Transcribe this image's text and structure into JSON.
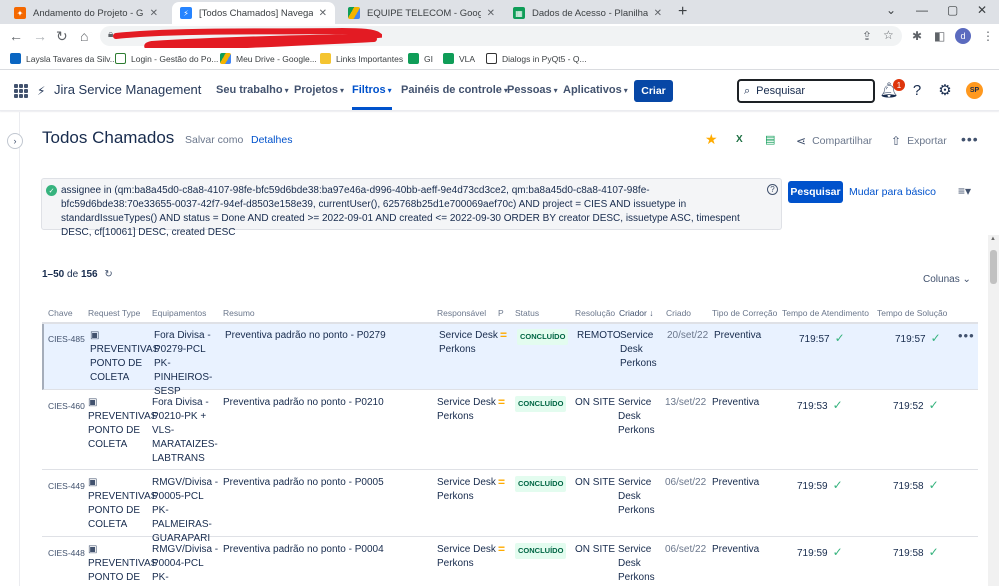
{
  "browser": {
    "tabs": [
      {
        "title": "Andamento do Projeto - Grafana",
        "icon": "grafana-icon",
        "color": "#f46800"
      },
      {
        "title": "[Todos Chamados] Navegador de ite",
        "icon": "jira-icon",
        "color": "#2684ff"
      },
      {
        "title": "EQUIPE TELECOM - Google Drive",
        "icon": "google-drive-icon",
        "color": "#1fa463"
      },
      {
        "title": "Dados de Acesso - Planilhas Google",
        "icon": "google-sheets-icon",
        "color": "#0f9d58"
      }
    ],
    "close_glyph": "✕",
    "new_tab": "+",
    "url": "",
    "profile_initial": "d",
    "bookmarks": [
      {
        "label": "Laysla Tavares da Silv...",
        "color": "#0a66c2"
      },
      {
        "label": "Login - Gestão do Po...",
        "color": "#2e7d32"
      },
      {
        "label": "Meu Drive - Google...",
        "color": "#1fa463"
      },
      {
        "label": "Links Importantes",
        "color": "#f4c430"
      },
      {
        "label": "GI",
        "color": "#0f9d58"
      },
      {
        "label": "VLA",
        "color": "#0f9d58"
      },
      {
        "label": "Dialogs in PyQt5 - Q...",
        "color": "#333333"
      }
    ]
  },
  "jira": {
    "product": "Jira Service Management",
    "nav": [
      "Seu trabalho",
      "Projetos",
      "Filtros",
      "Painéis de controle",
      "Pessoas",
      "Aplicativos"
    ],
    "create_label": "Criar",
    "search_placeholder": "Pesquisar",
    "notifications_count": "1",
    "avatar_initials": "SP"
  },
  "page": {
    "title": "Todos Chamados",
    "save_as": "Salvar como",
    "details": "Detalhes",
    "share": "Compartilhar",
    "export": "Exportar",
    "jql": "assignee in (qm:ba8a45d0-c8a8-4107-98fe-bfc59d6bde38:ba97e46a-d996-40bb-aeff-9e4d73cd3ce2, qm:ba8a45d0-c8a8-4107-98fe-bfc59d6bde38:70e33655-0037-42f7-94ef-d8503e158e39, currentUser(), 625768b25d1e700069aef70c) AND project = CIES AND issuetype in standardIssueTypes() AND status = Done AND created >= 2022-09-01 AND created <= 2022-09-30 ORDER BY creator DESC, issuetype ASC, timespent DESC, cf[10061] DESC, created DESC",
    "search_button": "Pesquisar",
    "switch_basic": "Mudar para básico",
    "pager_range": "1–50",
    "pager_of": "de",
    "pager_total": "156",
    "columns_label": "Colunas"
  },
  "table": {
    "headers": [
      "Chave",
      "Request Type",
      "Equipamentos",
      "Resumo",
      "Responsável",
      "P",
      "Status",
      "Resolução",
      "Criador",
      "Criado",
      "Tipo de Correção",
      "Tempo de Atendimento",
      "Tempo de Solução"
    ],
    "rows": [
      {
        "key": "CIES-485",
        "request_type": "PREVENTIVAS PONTO DE COLETA",
        "equipment": "Fora Divisa - P0279-PCL PK-PINHEIROS-SESP",
        "summary": "Preventiva padrão no ponto - P0279",
        "assignee": "Service Desk Perkons",
        "priority": "=",
        "status": "CONCLUÍDO",
        "resolution": "REMOTO",
        "creator": "Service Desk Perkons",
        "created": "20/set/22",
        "correction": "Preventiva",
        "t_attend": "719:57",
        "t_solve": "719:57"
      },
      {
        "key": "CIES-460",
        "request_type": "PREVENTIVAS PONTO DE COLETA",
        "equipment": "Fora Divisa - P0210-PK + VLS-MARATAIZES-LABTRANS",
        "summary": "Preventiva padrão no ponto - P0210",
        "assignee": "Service Desk Perkons",
        "priority": "=",
        "status": "CONCLUÍDO",
        "resolution": "ON SITE",
        "creator": "Service Desk Perkons",
        "created": "13/set/22",
        "correction": "Preventiva",
        "t_attend": "719:53",
        "t_solve": "719:52"
      },
      {
        "key": "CIES-449",
        "request_type": "PREVENTIVAS PONTO DE COLETA",
        "equipment": "RMGV/Divisa - P0005-PCL PK-PALMEIRAS-GUARAPARI",
        "summary": "Preventiva padrão no ponto - P0005",
        "assignee": "Service Desk Perkons",
        "priority": "=",
        "status": "CONCLUÍDO",
        "resolution": "ON SITE",
        "creator": "Service Desk Perkons",
        "created": "06/set/22",
        "correction": "Preventiva",
        "t_attend": "719:59",
        "t_solve": "719:58"
      },
      {
        "key": "CIES-448",
        "request_type": "PREVENTIVAS PONTO DE",
        "equipment": "RMGV/Divisa - P0004-PCL PK-GUARAPARI04-",
        "summary": "Preventiva padrão no ponto - P0004",
        "assignee": "Service Desk Perkons",
        "priority": "=",
        "status": "CONCLUÍDO",
        "resolution": "ON SITE",
        "creator": "Service Desk Perkons",
        "created": "06/set/22",
        "correction": "Preventiva",
        "t_attend": "719:59",
        "t_solve": "719:58"
      }
    ]
  },
  "colors": {
    "accent": "#0052cc",
    "create": "#0747a6",
    "status_done_bg": "#e3fcef",
    "status_done_fg": "#006644",
    "priority_medium": "#ffab00",
    "check": "#36b37e"
  }
}
